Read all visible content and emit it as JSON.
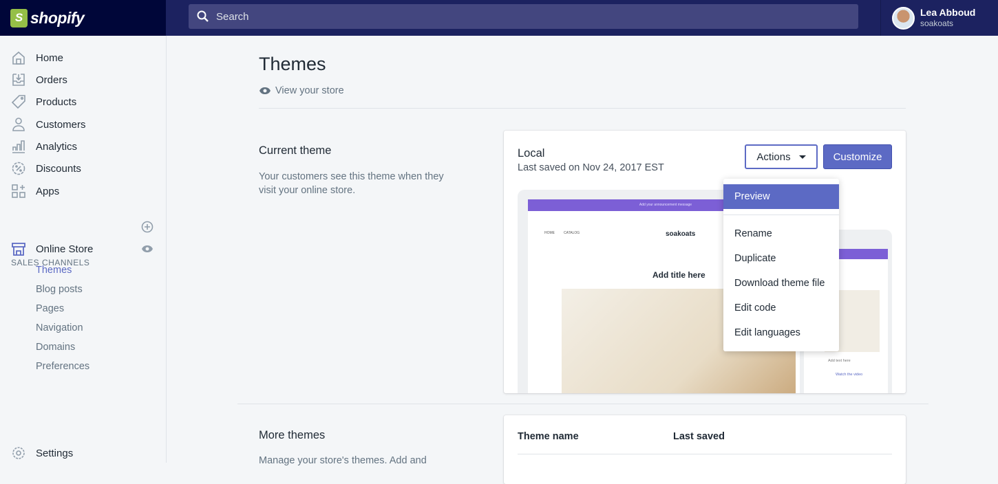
{
  "topbar": {
    "brand": "shopify",
    "search_placeholder": "Search",
    "user_name": "Lea Abboud",
    "store_name": "soakoats"
  },
  "sidebar": {
    "items": [
      {
        "label": "Home",
        "icon": "home-icon"
      },
      {
        "label": "Orders",
        "icon": "orders-icon"
      },
      {
        "label": "Products",
        "icon": "tag-icon"
      },
      {
        "label": "Customers",
        "icon": "person-icon"
      },
      {
        "label": "Analytics",
        "icon": "bar-chart-icon"
      },
      {
        "label": "Discounts",
        "icon": "discount-icon"
      },
      {
        "label": "Apps",
        "icon": "apps-icon"
      }
    ],
    "sales_channels_label": "SALES CHANNELS",
    "online_store": "Online Store",
    "sub_items": [
      "Themes",
      "Blog posts",
      "Pages",
      "Navigation",
      "Domains",
      "Preferences"
    ],
    "settings": "Settings"
  },
  "main": {
    "title": "Themes",
    "view_store": "View your store",
    "current_theme": {
      "heading": "Current theme",
      "description": "Your customers see this theme when they visit your online store.",
      "name": "Local",
      "last_saved": "Last saved on Nov 24, 2017 EST",
      "actions_label": "Actions",
      "customize_label": "Customize"
    },
    "actions_menu": [
      "Preview",
      "Rename",
      "Duplicate",
      "Download theme file",
      "Edit code",
      "Edit languages"
    ],
    "preview": {
      "announcement": "Add your announcement message",
      "nav": [
        "HOME",
        "CATALOG"
      ],
      "store": "soakoats",
      "title": "Add title here",
      "mobile_text": "Add text here",
      "mobile_video": "Watch the video"
    },
    "more_themes": {
      "heading": "More themes",
      "description": "Manage your store's themes. Add and",
      "columns": [
        "Theme name",
        "Last saved"
      ]
    }
  },
  "colors": {
    "accent": "#5c6ac4",
    "topbar": "#1c2260",
    "brand_bg": "#000639"
  }
}
